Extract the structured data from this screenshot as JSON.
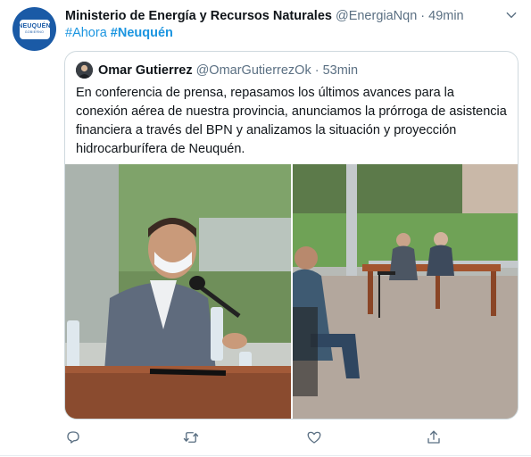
{
  "tweet": {
    "avatar_logo_text": "NEUQUÉN",
    "avatar_logo_sub": "GOBIERNO",
    "author_name": "Ministerio de Energía y Recursos Naturales",
    "author_handle": "@EnergiaNqn",
    "separator": "·",
    "time": "49min",
    "hashtag_1": "#Ahora",
    "hashtag_2": "#Neuquén",
    "caret_icon": "chevron-down-icon"
  },
  "quoted": {
    "author_name": "Omar Gutierrez",
    "author_handle": "@OmarGutierrezOk",
    "separator": "·",
    "time": "53min",
    "text": "En conferencia de prensa, repasamos los últimos avances para la conexión aérea de nuestra provincia, anunciamos la prórroga de asistencia financiera a través del BPN y analizamos la situación y proyección hidrocarburífera de Neuquén.",
    "photos": [
      "press-conference-closeup",
      "press-conference-wide"
    ]
  },
  "actions": {
    "icons": [
      "reply-icon",
      "retweet-icon",
      "like-icon",
      "share-icon"
    ]
  },
  "colors": {
    "link": "#1b95e0",
    "secondary_text": "#5b7083",
    "border": "#cfd9de",
    "avatar_bg": "#1a5aa6"
  }
}
